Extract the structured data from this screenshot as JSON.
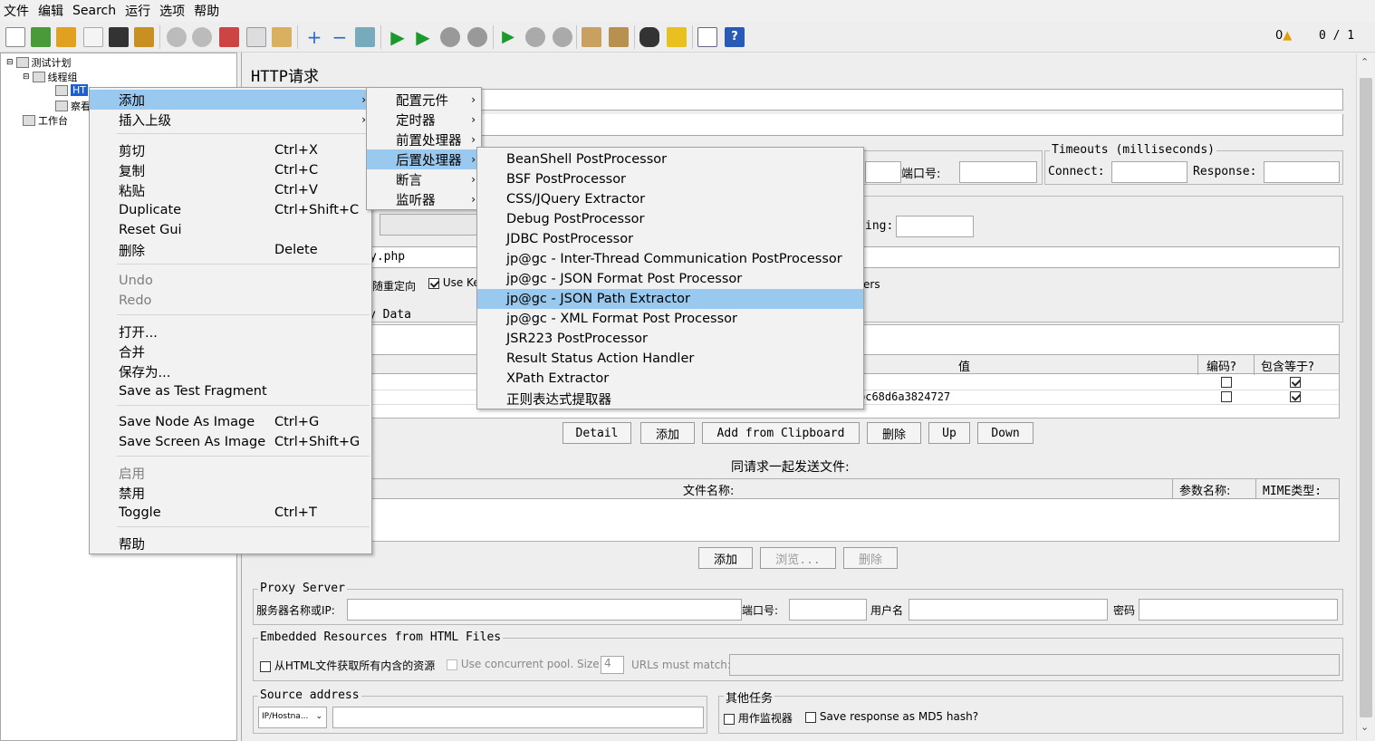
{
  "menubar": {
    "items": [
      "文件",
      "编辑",
      "Search",
      "运行",
      "选项",
      "帮助"
    ]
  },
  "toolbar": {
    "warn_count": "0",
    "threads": "0 / 1"
  },
  "tree": {
    "test_plan": "测试计划",
    "thread_group": "线程组",
    "http_request": "HT",
    "second_child": "察看",
    "workbench": "工作台"
  },
  "panel": {
    "title": "HTTP请求",
    "port_label": "端口号:",
    "timeouts_legend": "Timeouts (milliseconds)",
    "connect_label": "Connect:",
    "response_label": "Response:",
    "encoding_partial": "ing:",
    "path_partial": "y.php",
    "redirect_label": "随重定向",
    "use_ke_label": "Use Ke",
    "ers_partial": "ers",
    "body_tab_partial": "y Data",
    "param_col_value": "值",
    "param_col_encode": "编码?",
    "param_col_include": "包含等于?",
    "param_row_value": "bc68d6a3824727",
    "btn_detail": "Detail",
    "btn_add": "添加",
    "btn_add_clipboard": "Add from Clipboard",
    "btn_delete": "删除",
    "btn_up": "Up",
    "btn_down": "Down",
    "files_title": "同请求一起发送文件:",
    "files_col_name": "文件名称:",
    "files_col_param": "参数名称:",
    "files_col_mime": "MIME类型:",
    "files_btn_add": "添加",
    "files_btn_browse": "浏览...",
    "files_btn_delete": "删除",
    "proxy_legend": "Proxy Server",
    "proxy_host_label": "服务器名称或IP:",
    "proxy_port_label": "端口号:",
    "proxy_user_label": "用户名",
    "proxy_pass_label": "密码",
    "embedded_legend": "Embedded Resources from HTML Files",
    "embedded_fetch_label": "从HTML文件获取所有内含的资源",
    "embedded_pool_label": "Use concurrent pool. Size:",
    "embedded_pool_size": "4",
    "embedded_urls_label": "URLs must match:",
    "source_legend": "Source address",
    "source_select": "IP/Hostna...",
    "other_legend": "其他任务",
    "monitor_label": "用作监视器",
    "md5_label": "Save response as MD5 hash?"
  },
  "context_menu": {
    "items": [
      {
        "label": "添加",
        "shortcut": "",
        "submenu": true
      },
      {
        "label": "插入上级",
        "shortcut": "",
        "submenu": true
      },
      {
        "label": "剪切",
        "shortcut": "Ctrl+X"
      },
      {
        "label": "复制",
        "shortcut": "Ctrl+C"
      },
      {
        "label": "粘贴",
        "shortcut": "Ctrl+V"
      },
      {
        "label": "Duplicate",
        "shortcut": "Ctrl+Shift+C"
      },
      {
        "label": "Reset Gui",
        "shortcut": ""
      },
      {
        "label": "删除",
        "shortcut": "Delete"
      },
      {
        "label": "Undo",
        "shortcut": ""
      },
      {
        "label": "Redo",
        "shortcut": ""
      },
      {
        "label": "打开...",
        "shortcut": ""
      },
      {
        "label": "合并",
        "shortcut": ""
      },
      {
        "label": "保存为...",
        "shortcut": ""
      },
      {
        "label": "Save as Test Fragment",
        "shortcut": ""
      },
      {
        "label": "Save Node As Image",
        "shortcut": "Ctrl+G"
      },
      {
        "label": "Save Screen As Image",
        "shortcut": "Ctrl+Shift+G"
      },
      {
        "label": "启用",
        "shortcut": ""
      },
      {
        "label": "禁用",
        "shortcut": ""
      },
      {
        "label": "Toggle",
        "shortcut": "Ctrl+T"
      },
      {
        "label": "帮助",
        "shortcut": ""
      }
    ]
  },
  "add_submenu": {
    "items": [
      "配置元件",
      "定时器",
      "前置处理器",
      "后置处理器",
      "断言",
      "监听器"
    ]
  },
  "post_submenu": {
    "items": [
      "BeanShell PostProcessor",
      "BSF PostProcessor",
      "CSS/JQuery Extractor",
      "Debug PostProcessor",
      "JDBC PostProcessor",
      "jp@gc - Inter-Thread Communication PostProcessor",
      "jp@gc - JSON Format Post Processor",
      "jp@gc - JSON Path Extractor",
      "jp@gc - XML Format Post Processor",
      "JSR223 PostProcessor",
      "Result Status Action Handler",
      "XPath Extractor",
      "正则表达式提取器"
    ]
  },
  "colors": {
    "highlight": "#99c9ef",
    "menu_bg": "#f2f2f2",
    "panel_bg": "#eeeeee"
  }
}
